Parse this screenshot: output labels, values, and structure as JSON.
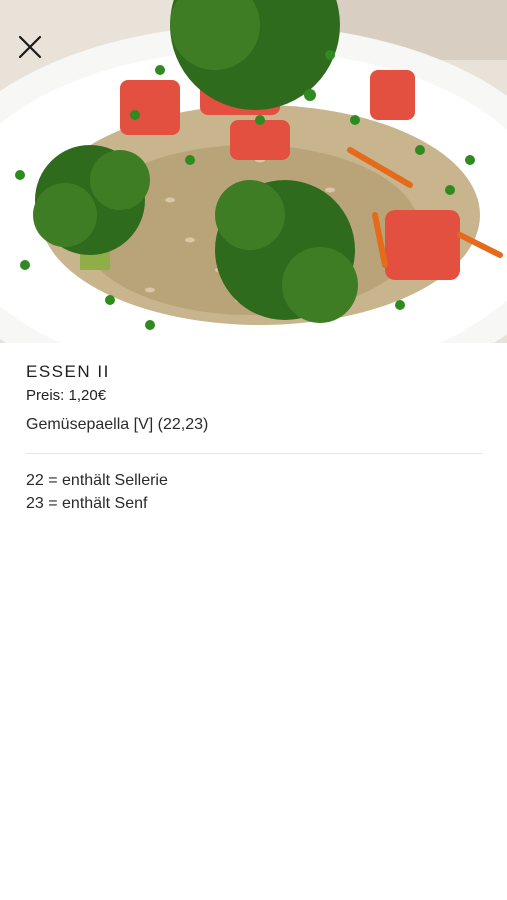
{
  "hero": {
    "image_subject": "vegetable paella with broccoli, tomato and parsley"
  },
  "close_icon": "close-icon",
  "meal": {
    "title": "ESSEN II",
    "price": "Preis: 1,20€",
    "dish": "Gemüsepaella [V] (22,23)"
  },
  "allergens": [
    {
      "text": "22 = enthält Sellerie"
    },
    {
      "text": "23 = enthält Senf"
    }
  ]
}
